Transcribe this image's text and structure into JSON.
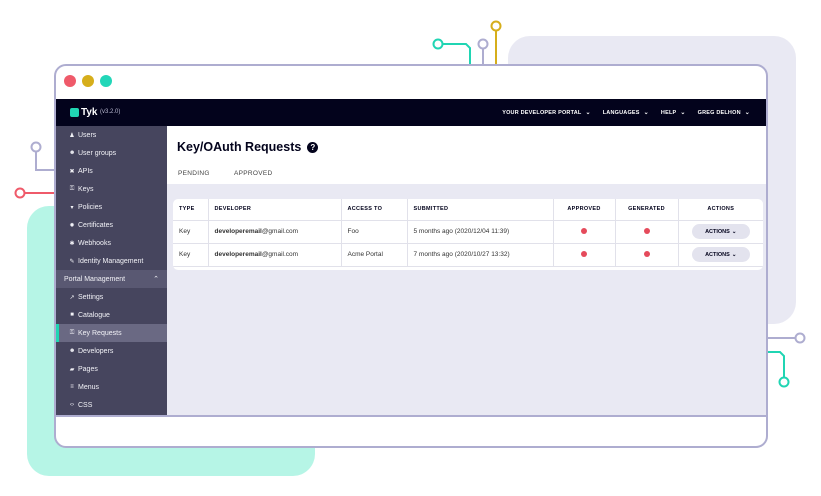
{
  "window": {
    "controls": [
      "close",
      "minimize",
      "maximize"
    ]
  },
  "topbar": {
    "logo": "Tyk",
    "version": "(v3.2.0)",
    "nav": [
      "YOUR DEVELOPER PORTAL",
      "LANGUAGES",
      "HELP",
      "GREG DELHON"
    ]
  },
  "sidebar": {
    "items_top": [
      {
        "icon": "user-icon",
        "glyph": "♟",
        "label": "Users"
      },
      {
        "icon": "user-groups-icon",
        "glyph": "☻",
        "label": "User groups"
      },
      {
        "icon": "apis-icon",
        "glyph": "✖",
        "label": "APIs"
      },
      {
        "icon": "keys-icon",
        "glyph": "⚿",
        "label": "Keys"
      },
      {
        "icon": "policies-icon",
        "glyph": "▾",
        "label": "Policies"
      },
      {
        "icon": "certificates-icon",
        "glyph": "✹",
        "label": "Certificates"
      },
      {
        "icon": "webhooks-icon",
        "glyph": "✱",
        "label": "Webhooks"
      },
      {
        "icon": "identity-icon",
        "glyph": "✎",
        "label": "Identity Management"
      }
    ],
    "section": "Portal Management",
    "items_portal": [
      {
        "icon": "settings-icon",
        "glyph": "↗",
        "label": "Settings"
      },
      {
        "icon": "catalogue-icon",
        "glyph": "■",
        "label": "Catalogue"
      },
      {
        "icon": "key-requests-icon",
        "glyph": "⚿",
        "label": "Key Requests"
      },
      {
        "icon": "developers-icon",
        "glyph": "☻",
        "label": "Developers"
      },
      {
        "icon": "pages-icon",
        "glyph": "▰",
        "label": "Pages"
      },
      {
        "icon": "menus-icon",
        "glyph": "≡",
        "label": "Menus"
      },
      {
        "icon": "css-icon",
        "glyph": "‹›",
        "label": "CSS"
      }
    ]
  },
  "main": {
    "title": "Key/OAuth Requests",
    "help_glyph": "?",
    "tabs": [
      "PENDING",
      "APPROVED"
    ],
    "table": {
      "headers": [
        "TYPE",
        "DEVELOPER",
        "ACCESS TO",
        "SUBMITTED",
        "APPROVED",
        "GENERATED",
        "ACTIONS"
      ],
      "rows": [
        {
          "type": "Key",
          "dev_bold": "developeremail",
          "dev_rest": "@gmail.com",
          "access": "Foo",
          "submitted": "5 months ago (2020/12/04 11:39)",
          "action": "ACTIONS"
        },
        {
          "type": "Key",
          "dev_bold": "developeremail",
          "dev_rest": "@gmail.com",
          "access": "Acme Portal",
          "submitted": "7 months ago (2020/10/27 13:32)",
          "action": "ACTIONS"
        }
      ]
    }
  },
  "colors": {
    "accent": "#20d5b3",
    "dark": "#03031c",
    "status": "#e54a5b",
    "mint": "#b6f5e6",
    "lavender": "#e9e9f3"
  }
}
